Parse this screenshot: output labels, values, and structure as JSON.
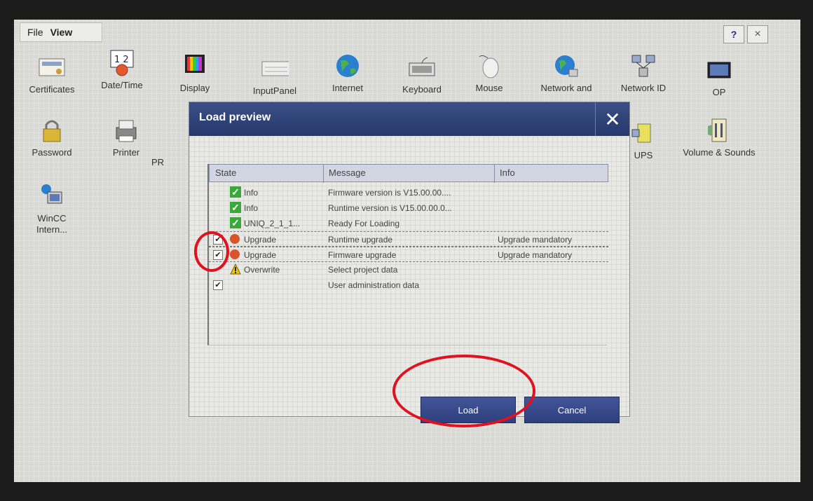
{
  "menu": {
    "file": "File",
    "view": "View"
  },
  "titlebar": {
    "help_label": "?",
    "close_label": "×"
  },
  "control_panel": {
    "items": [
      {
        "label": "Certificates",
        "icon": "certificate-icon"
      },
      {
        "label": "Date/Time",
        "icon": "calendar-clock-icon"
      },
      {
        "label": "Display",
        "icon": "display-icon"
      },
      {
        "label": "InputPanel",
        "icon": "keyboard-panel-icon"
      },
      {
        "label": "Internet",
        "icon": "globe-icon"
      },
      {
        "label": "Keyboard",
        "icon": "keyboard-icon"
      },
      {
        "label": "Mouse",
        "icon": "mouse-icon"
      },
      {
        "label": "Network and",
        "icon": "network-globe-icon"
      },
      {
        "label": "Network ID",
        "icon": "network-computers-icon"
      },
      {
        "label": "OP",
        "icon": "operator-panel-icon"
      },
      {
        "label": "Password",
        "icon": "lock-icon"
      },
      {
        "label": "Printer",
        "icon": "printer-icon"
      },
      {
        "label": "PR",
        "icon": "profinet-icon"
      },
      {
        "label": "UPS",
        "icon": "ups-icon"
      },
      {
        "label": "Volume & Sounds",
        "icon": "volume-icon"
      },
      {
        "label": "WinCC Intern...",
        "icon": "wincc-internet-icon"
      }
    ]
  },
  "dialog": {
    "title": "Load preview",
    "close_label": "✕",
    "columns": {
      "state": "State",
      "message": "Message",
      "info": "Info"
    },
    "rows": [
      {
        "checked": false,
        "state_icon": "ok",
        "state": "Info",
        "message": "Firmware version is V15.00.00....",
        "info": ""
      },
      {
        "checked": false,
        "state_icon": "ok",
        "state": "Info",
        "message": "Runtime version is V15.00.00.0...",
        "info": ""
      },
      {
        "checked": false,
        "state_icon": "ok",
        "state": "UNIQ_2_1_1...",
        "message": "Ready For Loading",
        "info": ""
      },
      {
        "checked": true,
        "state_icon": "upgrade",
        "state": "Upgrade",
        "message": "Runtime upgrade",
        "info": "Upgrade mandatory"
      },
      {
        "checked": true,
        "state_icon": "upgrade",
        "state": "Upgrade",
        "message": "Firmware upgrade",
        "info": "Upgrade mandatory"
      },
      {
        "checked": false,
        "state_icon": "warning",
        "state": "Overwrite",
        "message": "Select project data",
        "info": ""
      },
      {
        "checked": true,
        "state_icon": "none",
        "state": "",
        "message": "User administration data",
        "info": ""
      }
    ],
    "load_label": "Load",
    "cancel_label": "Cancel"
  },
  "colors": {
    "dialog_title_bg": "#2c3e73",
    "button_bg": "#3a4b8c",
    "annotation_red": "#e0121f",
    "ok_green": "#3aa83a"
  }
}
